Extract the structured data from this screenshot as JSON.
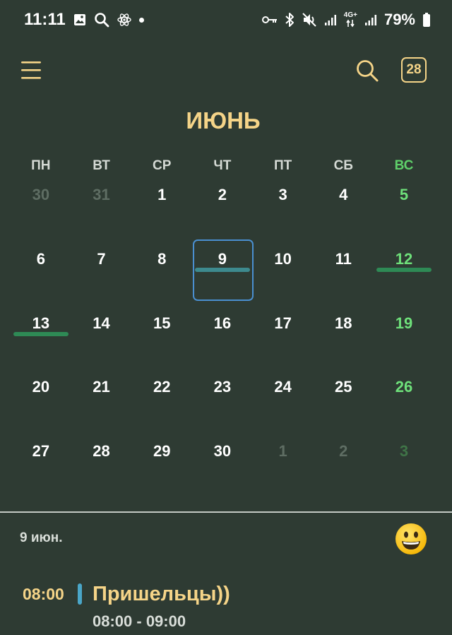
{
  "status_bar": {
    "time": "11:11",
    "battery": "79%",
    "network_label": "4G+",
    "left_icons": [
      "gallery-icon",
      "search-icon",
      "react-icon",
      "dot-icon"
    ],
    "right_icons": [
      "key-icon",
      "bluetooth-icon",
      "mute-icon",
      "signal-icon",
      "data-icon",
      "signal-icon",
      "battery-icon"
    ]
  },
  "header": {
    "today_number": "28",
    "month": "ИЮНЬ"
  },
  "weekdays": [
    "ПН",
    "ВТ",
    "СР",
    "ЧТ",
    "ПТ",
    "СБ",
    "ВС"
  ],
  "weeks": [
    [
      {
        "d": "30",
        "other": true
      },
      {
        "d": "31",
        "other": true
      },
      {
        "d": "1"
      },
      {
        "d": "2"
      },
      {
        "d": "3"
      },
      {
        "d": "4"
      },
      {
        "d": "5"
      }
    ],
    [
      {
        "d": "6"
      },
      {
        "d": "7"
      },
      {
        "d": "8"
      },
      {
        "d": "9",
        "selected": true,
        "event": "#3d8a8e"
      },
      {
        "d": "10"
      },
      {
        "d": "11"
      },
      {
        "d": "12",
        "event": "#2e8a55"
      }
    ],
    [
      {
        "d": "13",
        "event": "#2e8a55"
      },
      {
        "d": "14"
      },
      {
        "d": "15"
      },
      {
        "d": "16"
      },
      {
        "d": "17"
      },
      {
        "d": "18"
      },
      {
        "d": "19"
      }
    ],
    [
      {
        "d": "20"
      },
      {
        "d": "21"
      },
      {
        "d": "22"
      },
      {
        "d": "23"
      },
      {
        "d": "24"
      },
      {
        "d": "25"
      },
      {
        "d": "26"
      }
    ],
    [
      {
        "d": "27"
      },
      {
        "d": "28"
      },
      {
        "d": "29"
      },
      {
        "d": "30"
      },
      {
        "d": "1",
        "other": true
      },
      {
        "d": "2",
        "other": true
      },
      {
        "d": "3",
        "other": true
      }
    ]
  ],
  "selected_day": {
    "date_label": "9 июн.",
    "emoji": "grinning-face"
  },
  "events": [
    {
      "time": "08:00",
      "title": "Пришельцы))",
      "range": "08:00 - 09:00",
      "color": "#4aa6c8"
    }
  ],
  "colors": {
    "background": "#2e3b33",
    "accent": "#f5d488",
    "sunday": "#6ee07a",
    "selection": "#4a8fd0"
  }
}
